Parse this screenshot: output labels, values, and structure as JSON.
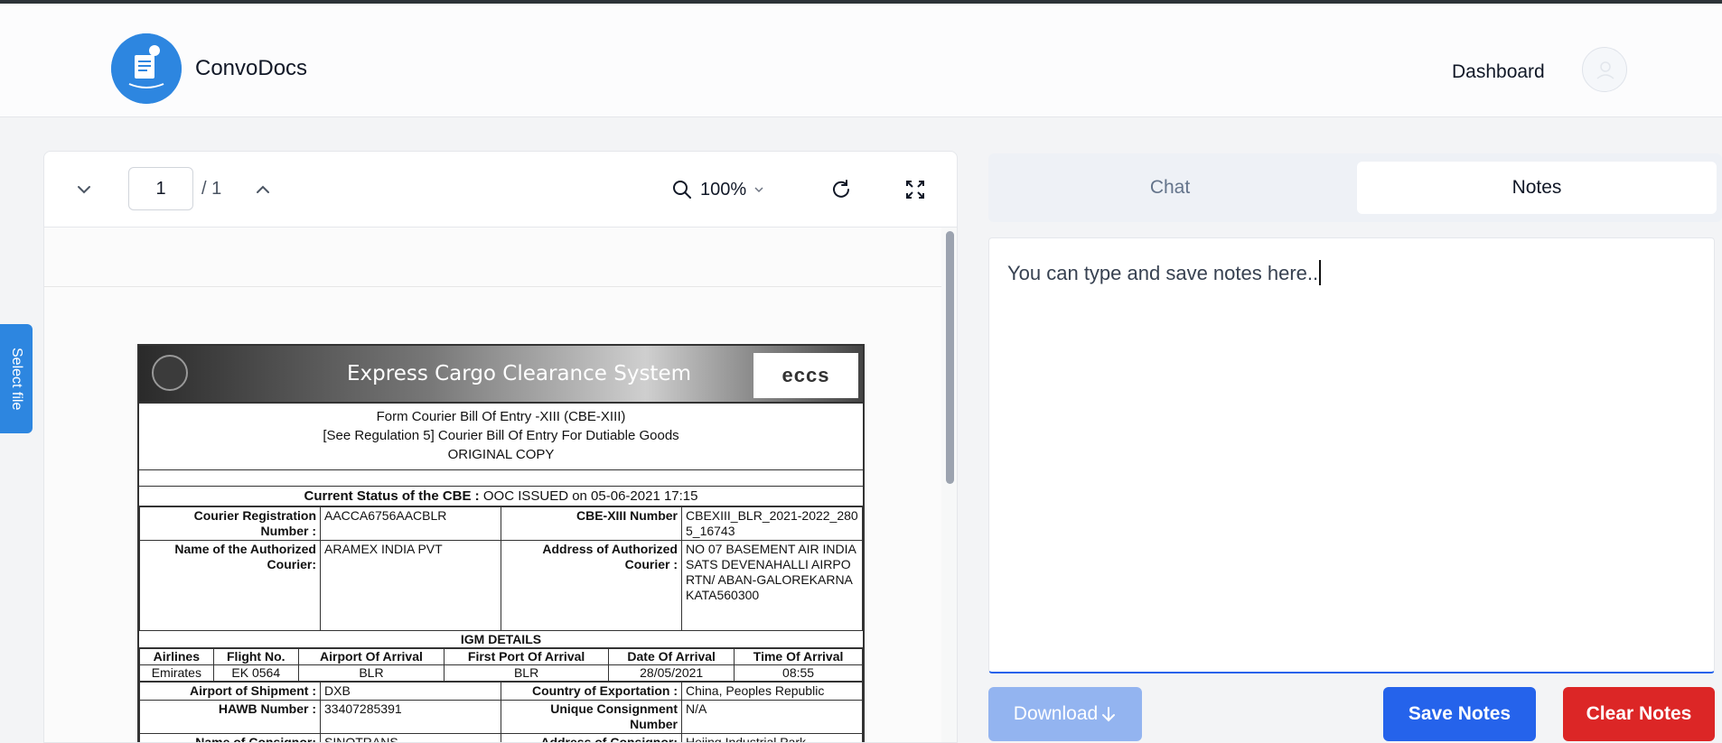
{
  "header": {
    "brand": "ConvoDocs",
    "nav": {
      "dashboard_label": "Dashboard"
    }
  },
  "viewer": {
    "page_current": "1",
    "page_total": "/ 1",
    "zoom": "100%"
  },
  "document": {
    "banner_title": "Express Cargo Clearance System",
    "logo_text": "eccs",
    "head_lines": [
      "Form Courier Bill Of Entry -XIII (CBE-XIII)",
      "[See Regulation 5] Courier Bill Of Entry For Dutiable Goods",
      "ORIGINAL COPY"
    ],
    "status_label": "Current Status of the CBE :",
    "status_value": "OOC ISSUED on 05-06-2021 17:15",
    "fields": {
      "courier_reg_label": "Courier Registration Number :",
      "courier_reg_value": "AACCA6756AACBLR",
      "cbe_label": "CBE-XIII Number",
      "cbe_value": "CBEXIII_BLR_2021-2022_2805_16743",
      "auth_courier_label": "Name of the Authorized Courier:",
      "auth_courier_value": "ARAMEX INDIA PVT",
      "auth_address_label": "Address of Authorized Courier :",
      "auth_address_value": "NO 07 BASEMENT AIR INDIA SATS DEVENAHALLI AIRPORTN/ ABAN-GALOREKARNAKATA560300"
    },
    "igm": {
      "title": "IGM DETAILS",
      "headers": [
        "Airlines",
        "Flight No.",
        "Airport Of Arrival",
        "First Port Of Arrival",
        "Date Of Arrival",
        "Time Of Arrival"
      ],
      "row": [
        "Emirates",
        "EK 0564",
        "BLR",
        "BLR",
        "28/05/2021",
        "08:55"
      ]
    },
    "shipment": {
      "airport_label": "Airport of Shipment :",
      "airport_value": "DXB",
      "country_label": "Country of Exportation :",
      "country_value": "China, Peoples Republic",
      "hawb_label": "HAWB Number :",
      "hawb_value": "33407285391",
      "ucn_label": "Unique Consignment Number",
      "ucn_value": "N/A",
      "consignor_label": "Name of Consignor:",
      "consignor_value": "SINOTRANS",
      "consignor_addr_label": "Address of Consignor:",
      "consignor_addr_value": "Hejing Industrial Park"
    }
  },
  "sidebar_tab": {
    "label": "Select file"
  },
  "panel": {
    "tabs": [
      {
        "label": "Chat"
      },
      {
        "label": "Notes"
      }
    ],
    "notes_text": "You can type and save notes here..",
    "buttons": {
      "download": "Download",
      "save": "Save Notes",
      "clear": "Clear Notes"
    }
  },
  "colors": {
    "primary": "#2563eb",
    "brand_blue": "#2d86e0",
    "danger": "#dc2626",
    "disabled_blue": "#93b4f0"
  }
}
